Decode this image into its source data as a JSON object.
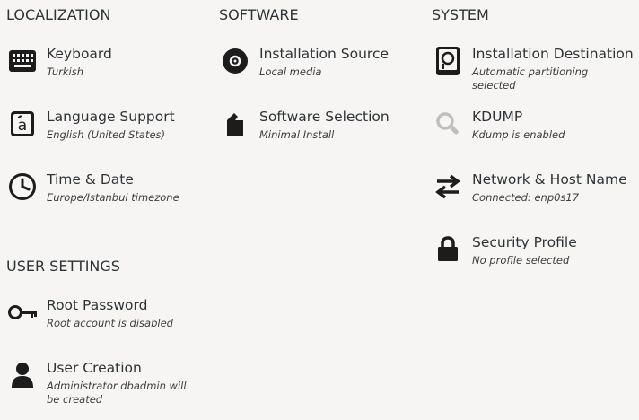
{
  "localization": {
    "title": "LOCALIZATION",
    "keyboard": {
      "label": "Keyboard",
      "status": "Turkish",
      "icon": "keyboard-icon"
    },
    "language": {
      "label": "Language Support",
      "status": "English (United States)",
      "icon": "language-icon"
    },
    "time": {
      "label": "Time & Date",
      "status": "Europe/Istanbul timezone",
      "icon": "clock-icon"
    }
  },
  "software": {
    "title": "SOFTWARE",
    "source": {
      "label": "Installation Source",
      "status": "Local media",
      "icon": "disc-icon"
    },
    "selection": {
      "label": "Software Selection",
      "status": "Minimal Install",
      "icon": "package-icon"
    }
  },
  "system": {
    "title": "SYSTEM",
    "destination": {
      "label": "Installation Destination",
      "status": "Automatic partitioning selected",
      "icon": "harddisk-icon"
    },
    "kdump": {
      "label": "KDUMP",
      "status": "Kdump is enabled",
      "icon": "magnifier-icon"
    },
    "network": {
      "label": "Network & Host Name",
      "status": "Connected: enp0s17",
      "icon": "network-arrows-icon"
    },
    "security": {
      "label": "Security Profile",
      "status": "No profile selected",
      "icon": "lock-icon"
    }
  },
  "user_settings": {
    "title": "USER SETTINGS",
    "root": {
      "label": "Root Password",
      "status": "Root account is disabled",
      "icon": "key-icon"
    },
    "user": {
      "label": "User Creation",
      "status": "Administrator dbadmin will be created",
      "icon": "user-icon"
    }
  }
}
